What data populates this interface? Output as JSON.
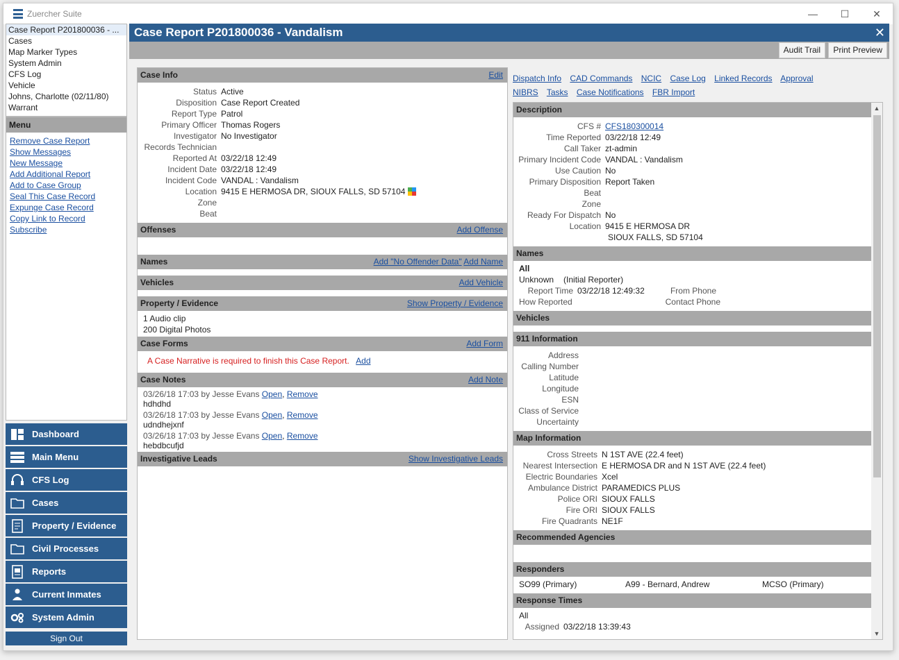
{
  "app": {
    "title": "Zuercher Suite"
  },
  "window_controls": {
    "minimize": "—",
    "maximize": "☐",
    "close": "✕"
  },
  "recent": [
    "Case Report P201800036 - ...",
    "Cases",
    "Map Marker Types",
    "System Admin",
    "CFS Log",
    "Vehicle",
    "Johns, Charlotte (02/11/80)",
    "Warrant"
  ],
  "menu": {
    "title": "Menu",
    "items": [
      "Remove Case Report",
      "Show Messages",
      "New Message",
      "Add Additional Report",
      "Add to Case Group",
      "Seal This Case Record",
      "Expunge Case Record",
      "Copy Link to Record",
      "Subscribe"
    ]
  },
  "nav": [
    {
      "label": "Dashboard",
      "icon": "dashboard-icon"
    },
    {
      "label": "Main Menu",
      "icon": "menu-icon"
    },
    {
      "label": "CFS Log",
      "icon": "headset-icon"
    },
    {
      "label": "Cases",
      "icon": "folder-icon"
    },
    {
      "label": "Property / Evidence",
      "icon": "evidence-icon"
    },
    {
      "label": "Civil Processes",
      "icon": "folder-icon"
    },
    {
      "label": "Reports",
      "icon": "reports-icon"
    },
    {
      "label": "Current Inmates",
      "icon": "inmates-icon"
    },
    {
      "label": "System Admin",
      "icon": "gears-icon"
    }
  ],
  "sign_out": "Sign Out",
  "page": {
    "title": "Case Report P201800036 - Vandalism",
    "close": "✕",
    "audit_trail": "Audit Trail",
    "print_preview": "Print Preview"
  },
  "case_info": {
    "title": "Case Info",
    "edit": "Edit",
    "fields": [
      {
        "k": "Status",
        "v": "Active"
      },
      {
        "k": "Disposition",
        "v": "Case Report Created"
      },
      {
        "k": "Report Type",
        "v": "Patrol"
      },
      {
        "k": "Primary Officer",
        "v": "Thomas Rogers"
      },
      {
        "k": "Investigator",
        "v": "No Investigator"
      },
      {
        "k": "Records Technician",
        "v": ""
      },
      {
        "k": "Reported At",
        "v": "03/22/18 12:49"
      },
      {
        "k": "Incident Date",
        "v": "03/22/18 12:49"
      },
      {
        "k": "Incident Code",
        "v": "VANDAL : Vandalism"
      },
      {
        "k": "Location",
        "v": "9415 E HERMOSA DR, SIOUX FALLS, SD 57104"
      },
      {
        "k": "Zone",
        "v": ""
      },
      {
        "k": "Beat",
        "v": ""
      }
    ]
  },
  "offenses": {
    "title": "Offenses",
    "action": "Add Offense"
  },
  "names": {
    "title": "Names",
    "action1": "Add \"No Offender Data\"",
    "action2": "Add Name"
  },
  "vehicles": {
    "title": "Vehicles",
    "action": "Add Vehicle"
  },
  "property": {
    "title": "Property / Evidence",
    "action": "Show Property / Evidence",
    "items": [
      "1 Audio clip",
      "200 Digital Photos"
    ]
  },
  "case_forms": {
    "title": "Case Forms",
    "action": "Add Form",
    "warning": "A Case Narrative is required to finish this Case Report.",
    "warning_link": "Add"
  },
  "case_notes": {
    "title": "Case Notes",
    "action": "Add Note",
    "notes": [
      {
        "meta": "03/26/18 17:03 by Jesse Evans",
        "open": "Open",
        "remove": "Remove",
        "text": "hdhdhd"
      },
      {
        "meta": "03/26/18 17:03 by Jesse Evans",
        "open": "Open",
        "remove": "Remove",
        "text": "udndhejxnf"
      },
      {
        "meta": "03/26/18 17:03 by Jesse Evans",
        "open": "Open",
        "remove": "Remove",
        "text": "hebdbcufjd"
      }
    ]
  },
  "investigative_leads": {
    "title": "Investigative Leads",
    "action": "Show Investigative Leads"
  },
  "right_links": [
    "Dispatch Info",
    "CAD Commands",
    "NCIC",
    "Case Log",
    "Linked Records",
    "Approval",
    "NIBRS",
    "Tasks",
    "Case Notifications",
    "FBR Import"
  ],
  "description": {
    "title": "Description",
    "fields": [
      {
        "k": "CFS #",
        "v": "CFS180300014"
      },
      {
        "k": "Time Reported",
        "v": "03/22/18 12:49"
      },
      {
        "k": "Call Taker",
        "v": "zt-admin"
      },
      {
        "k": "Primary Incident Code",
        "v": "VANDAL : Vandalism"
      },
      {
        "k": "Use Caution",
        "v": "No"
      },
      {
        "k": "Primary Disposition",
        "v": "Report Taken"
      },
      {
        "k": "Beat",
        "v": ""
      },
      {
        "k": "Zone",
        "v": ""
      },
      {
        "k": "Ready For Dispatch",
        "v": "No"
      },
      {
        "k": "Location",
        "v": "9415 E HERMOSA DR"
      }
    ],
    "location_line2": "SIOUX FALLS, SD 57104"
  },
  "cfs_names": {
    "title": "Names",
    "group": "All",
    "person": "Unknown",
    "role": "(Initial Reporter)",
    "report_time_label": "Report Time",
    "report_time": "03/22/18 12:49:32",
    "from_phone_label": "From Phone",
    "how_reported_label": "How Reported",
    "contact_phone_label": "Contact Phone"
  },
  "cfs_vehicles": {
    "title": "Vehicles"
  },
  "info911": {
    "title": "911 Information",
    "fields": [
      "Address",
      "Calling Number",
      "Latitude",
      "Longitude",
      "ESN",
      "Class of Service",
      "Uncertainty"
    ]
  },
  "map_info": {
    "title": "Map Information",
    "fields": [
      {
        "k": "Cross Streets",
        "v": "N 1ST AVE (22.4 feet)"
      },
      {
        "k": "Nearest Intersection",
        "v": "E HERMOSA DR and N 1ST AVE (22.4 feet)"
      },
      {
        "k": "Electric Boundaries",
        "v": "Xcel"
      },
      {
        "k": "Ambulance District",
        "v": "PARAMEDICS PLUS"
      },
      {
        "k": "Police ORI",
        "v": "SIOUX FALLS"
      },
      {
        "k": "Fire ORI",
        "v": "SIOUX FALLS"
      },
      {
        "k": "Fire Quadrants",
        "v": "NE1F"
      }
    ]
  },
  "recommended": {
    "title": "Recommended Agencies"
  },
  "responders": {
    "title": "Responders",
    "items": [
      "SO99 (Primary)",
      "A99 - Bernard, Andrew",
      "MCSO (Primary)"
    ]
  },
  "response_times": {
    "title": "Response Times",
    "group": "All",
    "assigned_label": "Assigned",
    "assigned": "03/22/18 13:39:43"
  }
}
